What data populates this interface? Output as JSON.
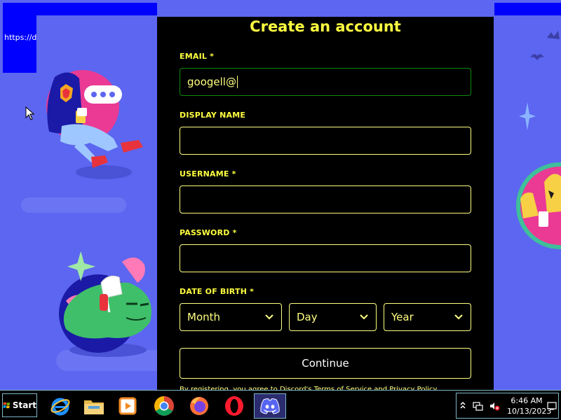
{
  "browser": {
    "url_fragment": "https://d"
  },
  "form": {
    "title": "Create an account",
    "email_label": "EMAIL *",
    "email_value": "googell@",
    "display_name_label": "DISPLAY NAME",
    "display_name_value": "",
    "username_label": "USERNAME *",
    "username_value": "",
    "password_label": "PASSWORD *",
    "password_value": "",
    "dob_label": "DATE OF BIRTH *",
    "month_placeholder": "Month",
    "day_placeholder": "Day",
    "year_placeholder": "Year",
    "continue_label": "Continue",
    "fine_print": "By registering, you agree to Discord's Terms of Service and Privacy Policy"
  },
  "taskbar": {
    "start_label": "Start",
    "apps": [
      {
        "icon": "internet-explorer-icon"
      },
      {
        "icon": "file-explorer-icon"
      },
      {
        "icon": "media-player-icon"
      },
      {
        "icon": "chrome-icon"
      },
      {
        "icon": "firefox-icon"
      },
      {
        "icon": "opera-icon"
      },
      {
        "icon": "discord-icon",
        "active": true
      }
    ],
    "time": "6:46 AM",
    "date": "10/13/2023"
  },
  "colors": {
    "background": "#5c66f0",
    "modal_bg": "#000000",
    "accent_yellow": "#ffff40",
    "focus_border": "#0c8a0c",
    "taskbar_border": "#7fb5c7"
  }
}
